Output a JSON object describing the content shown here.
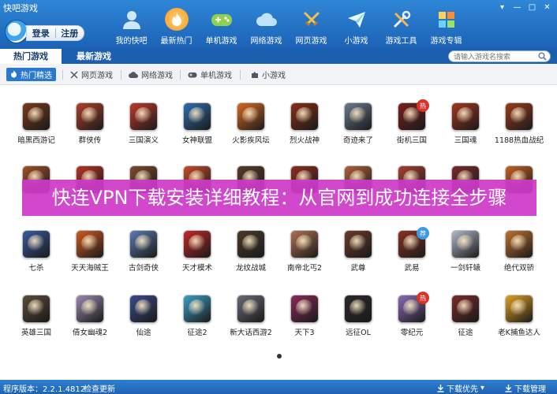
{
  "window": {
    "title": "快吧游戏",
    "min_glyph": "▾",
    "restore_glyph": "—",
    "max_glyph": "□",
    "close_glyph": "✕"
  },
  "account": {
    "login_label": "登录",
    "register_label": "注册"
  },
  "nav": [
    {
      "label": "我的快吧",
      "icon": "user-icon"
    },
    {
      "label": "最新热门",
      "icon": "flame-icon",
      "active": true
    },
    {
      "label": "单机游戏",
      "icon": "gamepad-icon"
    },
    {
      "label": "网络游戏",
      "icon": "cloud-icon"
    },
    {
      "label": "网页游戏",
      "icon": "swords-icon"
    },
    {
      "label": "小游戏",
      "icon": "paper-plane-icon"
    },
    {
      "label": "游戏工具",
      "icon": "tools-icon"
    },
    {
      "label": "游戏专辑",
      "icon": "grid-icon"
    }
  ],
  "tabs": {
    "hot": "热门游戏",
    "new": "最新游戏"
  },
  "search": {
    "placeholder": "请输入游戏名搜索"
  },
  "filters": [
    {
      "label": "热门精选",
      "icon": "flame-icon",
      "active": true
    },
    {
      "label": "网页游戏",
      "icon": "swords-icon"
    },
    {
      "label": "网络游戏",
      "icon": "cloud-icon"
    },
    {
      "label": "单机游戏",
      "icon": "gamepad-icon"
    },
    {
      "label": "小游戏",
      "icon": "paper-plane-icon"
    }
  ],
  "games": [
    {
      "name": "暗黑西游记",
      "color": "#7a3a1c"
    },
    {
      "name": "群侠传",
      "color": "#b0402a"
    },
    {
      "name": "三国演义",
      "color": "#c0392b"
    },
    {
      "name": "女神联盟",
      "color": "#2e6fb0"
    },
    {
      "name": "火影疾风坛",
      "color": "#d86a1f"
    },
    {
      "name": "烈火战神",
      "color": "#8a2f14"
    },
    {
      "name": "奇迹来了",
      "color": "#6b7a8f"
    },
    {
      "name": "街机三国",
      "color": "#7b1e1e",
      "badge": "热"
    },
    {
      "name": "三国魂",
      "color": "#a3361f"
    },
    {
      "name": "1188热血战纪",
      "color": "#9c3b1a"
    },
    {
      "name": "",
      "color": "#a05028"
    },
    {
      "name": "",
      "color": "#b83224"
    },
    {
      "name": "",
      "color": "#7c4a2c"
    },
    {
      "name": "",
      "color": "#c84a2a"
    },
    {
      "name": "",
      "color": "#5a3a2a"
    },
    {
      "name": "",
      "color": "#8f2d1e"
    },
    {
      "name": "",
      "color": "#b0603a"
    },
    {
      "name": "",
      "color": "#a84030"
    },
    {
      "name": "",
      "color": "#7a2a2a"
    },
    {
      "name": "",
      "color": "#c66020"
    },
    {
      "name": "七杀",
      "color": "#3a5aa0"
    },
    {
      "name": "天天海贼王",
      "color": "#d05a20"
    },
    {
      "name": "古剑奇侠",
      "color": "#5a7ab0"
    },
    {
      "name": "天才模术",
      "color": "#c42828"
    },
    {
      "name": "龙纹战城",
      "color": "#4a3a2a"
    },
    {
      "name": "南帝北丐2",
      "color": "#b07050"
    },
    {
      "name": "武尊",
      "color": "#6a3a2a"
    },
    {
      "name": "武易",
      "color": "#8a3020",
      "badge": "荐"
    },
    {
      "name": "一剑轩辕",
      "color": "#b0b8c8"
    },
    {
      "name": "绝代双骄",
      "color": "#c07030"
    },
    {
      "name": "英雄三国",
      "color": "#5a4a3a"
    },
    {
      "name": "倩女幽魂2",
      "color": "#9a8ab0"
    },
    {
      "name": "仙途",
      "color": "#3a4a8a"
    },
    {
      "name": "征途2",
      "color": "#3aa0c8"
    },
    {
      "name": "新大话西游2",
      "color": "#6a6a7a"
    },
    {
      "name": "天下3",
      "color": "#8a2a5a"
    },
    {
      "name": "远征OL",
      "color": "#2a2a2a"
    },
    {
      "name": "零纪元",
      "color": "#8a6ab8",
      "badge": "热"
    },
    {
      "name": "征途",
      "color": "#7a2a2a"
    },
    {
      "name": "老K捕鱼达人",
      "color": "#e0a020"
    }
  ],
  "banner": {
    "text": "快连VPN下载安装详细教程：从官网到成功连接全步骤"
  },
  "status": {
    "version": "程序版本：2.2.1.4812",
    "update": "检查更新",
    "priority": "下载优先",
    "manager": "下载管理"
  },
  "colors": {
    "header": "#1f6cbf",
    "accent": "#2a79cf",
    "banner": "#ce3ac8",
    "badge_hot": "#d8322a",
    "badge_rec": "#3f9ae0"
  }
}
